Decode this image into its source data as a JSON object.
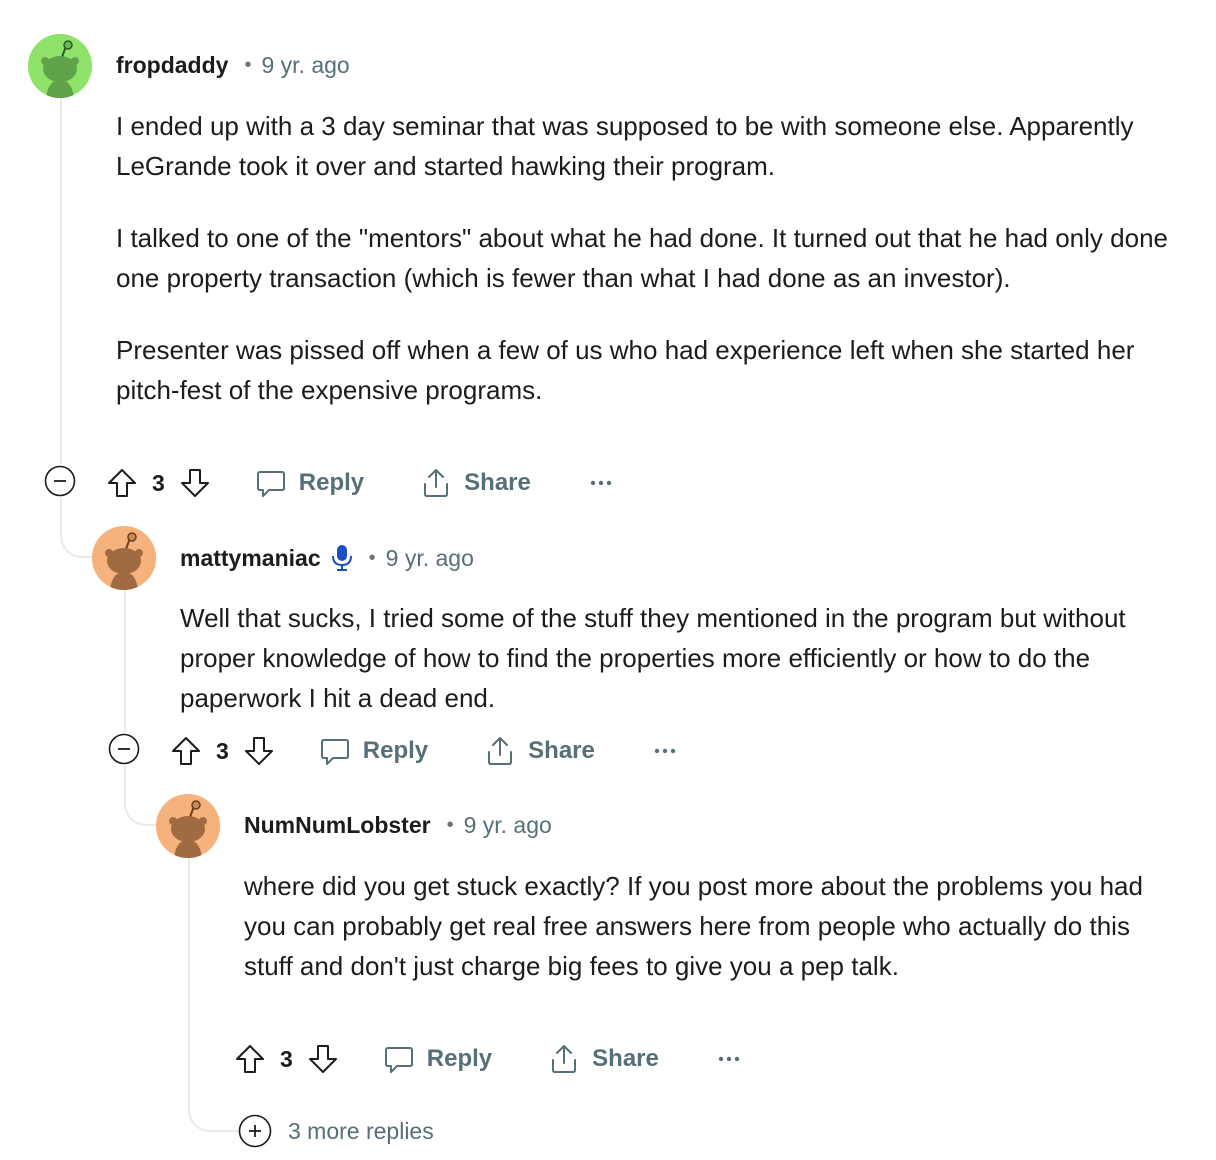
{
  "comments": [
    {
      "author": "fropdaddy",
      "time": "9 yr. ago",
      "avatar_color": "#8fe36a",
      "paragraphs": [
        "I ended up with a 3 day seminar that was supposed to be with someone else. Apparently LeGrande took it over and started hawking their program.",
        "I talked to one of the \"mentors\" about what he had done. It turned out that he had only done one property transaction (which is fewer than what I had done as an investor).",
        "Presenter was pissed off when a few of us who had experience left when she started her pitch-fest of the expensive programs."
      ],
      "score": "3",
      "reply_label": "Reply",
      "share_label": "Share"
    },
    {
      "author": "mattymaniac",
      "time": "9 yr. ago",
      "avatar_color": "#f5b27c",
      "badge_icon": "microphone-icon",
      "paragraphs": [
        "Well that sucks, I tried some of the stuff they mentioned in the program but without proper knowledge of how to find the properties more efficiently or how to do the paperwork I hit a dead end."
      ],
      "score": "3",
      "reply_label": "Reply",
      "share_label": "Share"
    },
    {
      "author": "NumNumLobster",
      "time": "9 yr. ago",
      "avatar_color": "#f5b27c",
      "paragraphs": [
        "where did you get stuck exactly? If you post more about the problems you had you can probably get real free answers here from people who actually do this stuff and don't just charge big fees to give you a pep talk."
      ],
      "score": "3",
      "reply_label": "Reply",
      "share_label": "Share"
    }
  ],
  "more_replies_label": "3 more replies",
  "colors": {
    "thread_line": "#e5ebee",
    "meta_gray": "#576f76",
    "mic_blue": "#1d4fc4"
  }
}
